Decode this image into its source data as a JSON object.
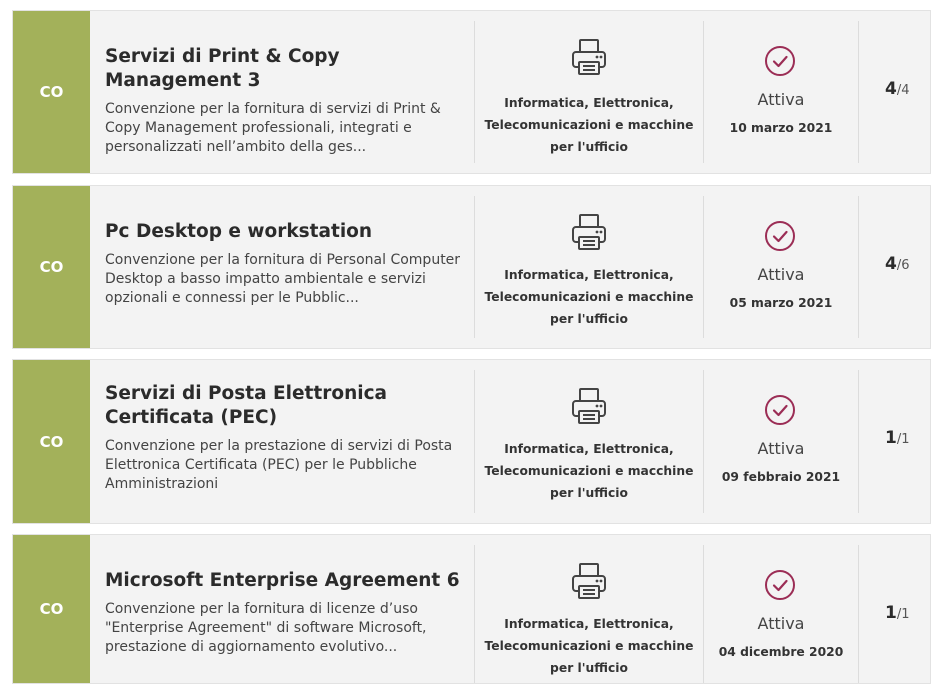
{
  "accent_color": "#a3b15a",
  "status_icon_color": "#9b2d55",
  "items": [
    {
      "badge": "CO",
      "title": "Servizi di Print & Copy Management 3",
      "description": "Convenzione per la fornitura di servizi di Print & Copy Management professionali, integrati e personalizzati nell’ambito della ges...",
      "category_icon": "printer-icon",
      "category": "Informatica, Elettronica, Telecomunicazioni e macchine per l'ufficio",
      "status_icon": "check-circle-icon",
      "status": "Attiva",
      "date": "10 marzo 2021",
      "count": "4",
      "total": "/4"
    },
    {
      "badge": "CO",
      "title": "Pc Desktop e workstation",
      "description": "Convenzione per la fornitura di Personal Computer Desktop a basso impatto ambientale e servizi opzionali e connessi per le Pubblic...",
      "category_icon": "printer-icon",
      "category": "Informatica, Elettronica, Telecomunicazioni e macchine per l'ufficio",
      "status_icon": "check-circle-icon",
      "status": "Attiva",
      "date": "05 marzo 2021",
      "count": "4",
      "total": "/6"
    },
    {
      "badge": "CO",
      "title": "Servizi di Posta Elettronica Certificata (PEC)",
      "description": "Convenzione per la prestazione di servizi di Posta Elettronica Certificata (PEC) per le Pubbliche Amministrazioni",
      "category_icon": "printer-icon",
      "category": "Informatica, Elettronica, Telecomunicazioni e macchine per l'ufficio",
      "status_icon": "check-circle-icon",
      "status": "Attiva",
      "date": "09 febbraio 2021",
      "count": "1",
      "total": "/1"
    },
    {
      "badge": "CO",
      "title": "Microsoft Enterprise Agreement 6",
      "description": "Convenzione per la fornitura di licenze d’uso \"Enterprise Agreement\" di software Microsoft, prestazione di aggiornamento evolutivo...",
      "category_icon": "printer-icon",
      "category": "Informatica, Elettronica, Telecomunicazioni e macchine per l'ufficio",
      "status_icon": "check-circle-icon",
      "status": "Attiva",
      "date": "04 dicembre 2020",
      "count": "1",
      "total": "/1"
    }
  ]
}
